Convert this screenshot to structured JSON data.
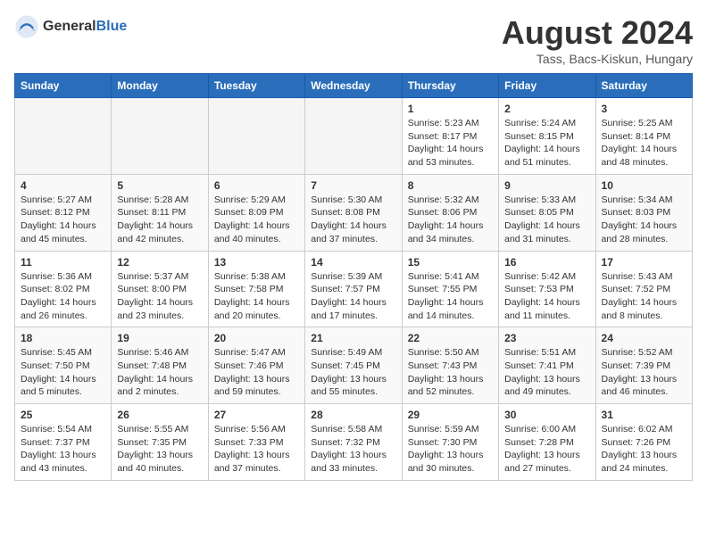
{
  "header": {
    "logo_general": "General",
    "logo_blue": "Blue",
    "month_title": "August 2024",
    "location": "Tass, Bacs-Kiskun, Hungary"
  },
  "weekdays": [
    "Sunday",
    "Monday",
    "Tuesday",
    "Wednesday",
    "Thursday",
    "Friday",
    "Saturday"
  ],
  "weeks": [
    [
      {
        "day": "",
        "empty": true
      },
      {
        "day": "",
        "empty": true
      },
      {
        "day": "",
        "empty": true
      },
      {
        "day": "",
        "empty": true
      },
      {
        "day": "1",
        "sunrise": "5:23 AM",
        "sunset": "8:17 PM",
        "daylight": "14 hours and 53 minutes."
      },
      {
        "day": "2",
        "sunrise": "5:24 AM",
        "sunset": "8:15 PM",
        "daylight": "14 hours and 51 minutes."
      },
      {
        "day": "3",
        "sunrise": "5:25 AM",
        "sunset": "8:14 PM",
        "daylight": "14 hours and 48 minutes."
      }
    ],
    [
      {
        "day": "4",
        "sunrise": "5:27 AM",
        "sunset": "8:12 PM",
        "daylight": "14 hours and 45 minutes."
      },
      {
        "day": "5",
        "sunrise": "5:28 AM",
        "sunset": "8:11 PM",
        "daylight": "14 hours and 42 minutes."
      },
      {
        "day": "6",
        "sunrise": "5:29 AM",
        "sunset": "8:09 PM",
        "daylight": "14 hours and 40 minutes."
      },
      {
        "day": "7",
        "sunrise": "5:30 AM",
        "sunset": "8:08 PM",
        "daylight": "14 hours and 37 minutes."
      },
      {
        "day": "8",
        "sunrise": "5:32 AM",
        "sunset": "8:06 PM",
        "daylight": "14 hours and 34 minutes."
      },
      {
        "day": "9",
        "sunrise": "5:33 AM",
        "sunset": "8:05 PM",
        "daylight": "14 hours and 31 minutes."
      },
      {
        "day": "10",
        "sunrise": "5:34 AM",
        "sunset": "8:03 PM",
        "daylight": "14 hours and 28 minutes."
      }
    ],
    [
      {
        "day": "11",
        "sunrise": "5:36 AM",
        "sunset": "8:02 PM",
        "daylight": "14 hours and 26 minutes."
      },
      {
        "day": "12",
        "sunrise": "5:37 AM",
        "sunset": "8:00 PM",
        "daylight": "14 hours and 23 minutes."
      },
      {
        "day": "13",
        "sunrise": "5:38 AM",
        "sunset": "7:58 PM",
        "daylight": "14 hours and 20 minutes."
      },
      {
        "day": "14",
        "sunrise": "5:39 AM",
        "sunset": "7:57 PM",
        "daylight": "14 hours and 17 minutes."
      },
      {
        "day": "15",
        "sunrise": "5:41 AM",
        "sunset": "7:55 PM",
        "daylight": "14 hours and 14 minutes."
      },
      {
        "day": "16",
        "sunrise": "5:42 AM",
        "sunset": "7:53 PM",
        "daylight": "14 hours and 11 minutes."
      },
      {
        "day": "17",
        "sunrise": "5:43 AM",
        "sunset": "7:52 PM",
        "daylight": "14 hours and 8 minutes."
      }
    ],
    [
      {
        "day": "18",
        "sunrise": "5:45 AM",
        "sunset": "7:50 PM",
        "daylight": "14 hours and 5 minutes."
      },
      {
        "day": "19",
        "sunrise": "5:46 AM",
        "sunset": "7:48 PM",
        "daylight": "14 hours and 2 minutes."
      },
      {
        "day": "20",
        "sunrise": "5:47 AM",
        "sunset": "7:46 PM",
        "daylight": "13 hours and 59 minutes."
      },
      {
        "day": "21",
        "sunrise": "5:49 AM",
        "sunset": "7:45 PM",
        "daylight": "13 hours and 55 minutes."
      },
      {
        "day": "22",
        "sunrise": "5:50 AM",
        "sunset": "7:43 PM",
        "daylight": "13 hours and 52 minutes."
      },
      {
        "day": "23",
        "sunrise": "5:51 AM",
        "sunset": "7:41 PM",
        "daylight": "13 hours and 49 minutes."
      },
      {
        "day": "24",
        "sunrise": "5:52 AM",
        "sunset": "7:39 PM",
        "daylight": "13 hours and 46 minutes."
      }
    ],
    [
      {
        "day": "25",
        "sunrise": "5:54 AM",
        "sunset": "7:37 PM",
        "daylight": "13 hours and 43 minutes."
      },
      {
        "day": "26",
        "sunrise": "5:55 AM",
        "sunset": "7:35 PM",
        "daylight": "13 hours and 40 minutes."
      },
      {
        "day": "27",
        "sunrise": "5:56 AM",
        "sunset": "7:33 PM",
        "daylight": "13 hours and 37 minutes."
      },
      {
        "day": "28",
        "sunrise": "5:58 AM",
        "sunset": "7:32 PM",
        "daylight": "13 hours and 33 minutes."
      },
      {
        "day": "29",
        "sunrise": "5:59 AM",
        "sunset": "7:30 PM",
        "daylight": "13 hours and 30 minutes."
      },
      {
        "day": "30",
        "sunrise": "6:00 AM",
        "sunset": "7:28 PM",
        "daylight": "13 hours and 27 minutes."
      },
      {
        "day": "31",
        "sunrise": "6:02 AM",
        "sunset": "7:26 PM",
        "daylight": "13 hours and 24 minutes."
      }
    ]
  ]
}
